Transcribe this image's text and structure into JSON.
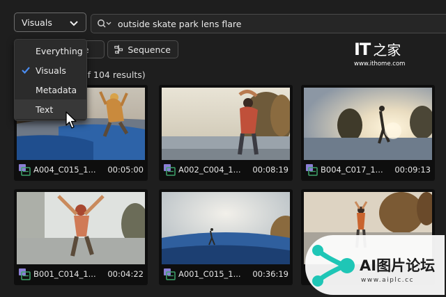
{
  "toolbar": {
    "mode_select_value": "Visuals",
    "search_value": "outside skate park lens flare",
    "clip_button_label": "ce",
    "sequence_button_label": "Sequence",
    "results_count": "of 104 results)"
  },
  "mode_menu": {
    "items": [
      {
        "label": "Everything",
        "selected": false
      },
      {
        "label": "Visuals",
        "selected": true
      },
      {
        "label": "Metadata",
        "selected": false
      },
      {
        "label": "Text",
        "selected": false,
        "hovered": true
      }
    ]
  },
  "clips": [
    {
      "name": "A004_C015_1...",
      "duration": "00:05:00"
    },
    {
      "name": "A002_C004_1...",
      "duration": "00:08:19"
    },
    {
      "name": "B004_C017_1...",
      "duration": "00:09:13"
    },
    {
      "name": "B001_C014_1...",
      "duration": "00:04:22"
    },
    {
      "name": "A001_C015_1...",
      "duration": "00:36:19"
    },
    {
      "name": "",
      "duration": ""
    }
  ],
  "watermarks": {
    "ithome_logo": "IT之家",
    "ithome_logo_it": "IT",
    "ithome_logo_zh": "之家",
    "ithome_url": "www.ithome.com",
    "aiplc_title": "AI图片论坛",
    "aiplc_url": "www.aiplc.cc"
  },
  "colors": {
    "background": "#1e1e1e",
    "accent_blue": "#4a8cf0",
    "clip_icon_purple": "#8b7fd6",
    "clip_icon_green": "#3fa36b",
    "aiplc_teal": "#1fc6b6"
  }
}
